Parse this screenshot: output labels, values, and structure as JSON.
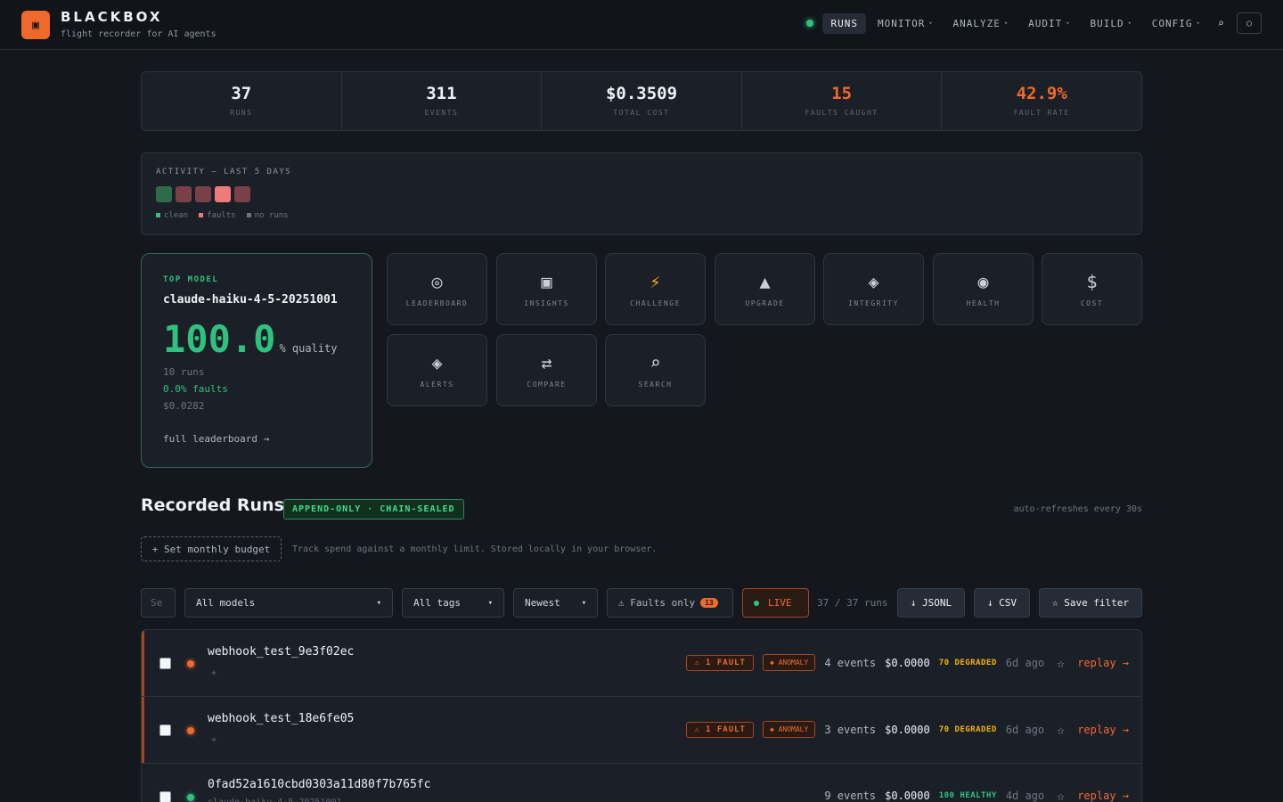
{
  "header": {
    "logo_glyph": "▣",
    "brand": "BLACKBOX",
    "tagline": "flight recorder for AI agents",
    "nav": [
      {
        "label": "RUNS",
        "active": true
      },
      {
        "label": "MONITOR"
      },
      {
        "label": "ANALYZE"
      },
      {
        "label": "AUDIT"
      },
      {
        "label": "BUILD"
      },
      {
        "label": "CONFIG"
      }
    ],
    "caret": "▾",
    "search_glyph": "⌕",
    "theme_glyph": "○"
  },
  "stats": [
    {
      "value": "37",
      "label": "RUNS"
    },
    {
      "value": "311",
      "label": "EVENTS"
    },
    {
      "value": "$0.3509",
      "label": "TOTAL COST"
    },
    {
      "value": "15",
      "label": "FAULTS CAUGHT"
    },
    {
      "value": "42.9%",
      "label": "FAULT RATE"
    }
  ],
  "activity": {
    "title": "ACTIVITY — LAST 5 DAYS",
    "days": [
      "clean",
      "faults",
      "faults",
      "faults-high",
      "faults"
    ],
    "legend": [
      "clean",
      "faults",
      "no runs"
    ],
    "colors": {
      "clean": "#2f6b4a",
      "faults": "#7a3f47",
      "faults-high": "#f07a7a",
      "no_runs": "#4a525c"
    }
  },
  "top_model": {
    "label": "TOP MODEL",
    "name": "claude-haiku-4-5-20251001",
    "score": "100.0",
    "score_unit": "% quality",
    "runs": "10 runs",
    "faults": "0.0% faults",
    "cost": "$0.0282",
    "link": "full leaderboard →"
  },
  "tools": [
    {
      "label": "LEADERBOARD",
      "glyph": "◎",
      "icon": "leaderboard-icon"
    },
    {
      "label": "INSIGHTS",
      "glyph": "▣",
      "icon": "insights-icon"
    },
    {
      "label": "CHALLENGE",
      "glyph": "⚡",
      "icon": "bolt-icon"
    },
    {
      "label": "UPGRADE",
      "glyph": "▲",
      "icon": "upgrade-icon"
    },
    {
      "label": "INTEGRITY",
      "glyph": "◈",
      "icon": "integrity-icon"
    },
    {
      "label": "HEALTH",
      "glyph": "◉",
      "icon": "health-icon"
    },
    {
      "label": "COST",
      "glyph": "$",
      "icon": "cost-icon"
    },
    {
      "label": "ALERTS",
      "glyph": "◈",
      "icon": "alerts-icon"
    },
    {
      "label": "COMPARE",
      "glyph": "⇄",
      "icon": "compare-icon"
    },
    {
      "label": "SEARCH",
      "glyph": "⌕",
      "icon": "search-icon"
    }
  ],
  "runs_section": {
    "title": "Recorded Runs",
    "badge": "APPEND-ONLY · CHAIN-SEALED",
    "refresh_note": "auto-refreshes every 30s",
    "budget_button": "+ Set monthly budget",
    "budget_note": "Track spend against a monthly limit. Stored locally in your browser."
  },
  "filters": {
    "search_placeholder": "Se",
    "model": "All models",
    "tags": "All tags",
    "sort": "Newest",
    "faults_only": "⚠ Faults only",
    "faults_count": "13",
    "live": "LIVE",
    "count": "37 / 37 runs",
    "jsonl": "↓ JSONL",
    "csv": "↓ CSV",
    "save": "☆ Save filter",
    "select_caret": "▾"
  },
  "runs": [
    {
      "name": "webhook_test_9e3f02ec",
      "sub": "+",
      "fault_tag": "⚠ 1 FAULT",
      "anomaly_tag": "◆ ANOMALY",
      "events": "4 events",
      "cost": "$0.0000",
      "health": "70 DEGRADED",
      "age": "6d ago",
      "star": "☆",
      "replay": "replay →",
      "status": "fault"
    },
    {
      "name": "webhook_test_18e6fe05",
      "sub": "+",
      "fault_tag": "⚠ 1 FAULT",
      "anomaly_tag": "◆ ANOMALY",
      "events": "3 events",
      "cost": "$0.0000",
      "health": "70 DEGRADED",
      "age": "6d ago",
      "star": "☆",
      "replay": "replay →",
      "status": "fault"
    },
    {
      "name": "0fad52a1610cbd0303a11d80f7b765fc",
      "sub": "claude-haiku-4-5-20251001",
      "fault_tag": "",
      "anomaly_tag": "",
      "events": "9 events",
      "cost": "$0.0000",
      "health": "100 HEALTHY",
      "age": "4d ago",
      "star": "☆",
      "replay": "replay →",
      "status": "ok"
    }
  ]
}
